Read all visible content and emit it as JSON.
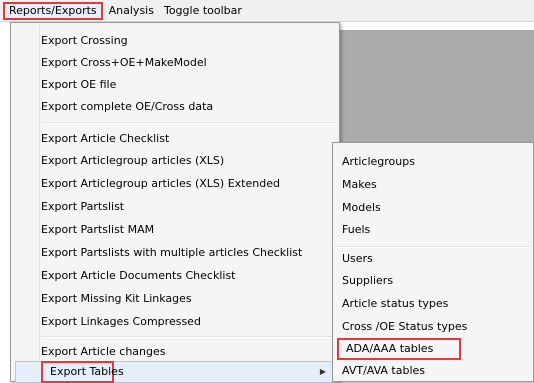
{
  "menubar": {
    "items": [
      {
        "label": "Reports/Exports"
      },
      {
        "label": "Analysis"
      },
      {
        "label": "Toggle toolbar"
      }
    ]
  },
  "main_menu": {
    "items": [
      "Export Crossing",
      "Export Cross+OE+MakeModel",
      "Export OE file",
      "Export complete OE/Cross data",
      "Export Article Checklist",
      "Export Articlegroup articles (XLS)",
      "Export Articlegroup articles (XLS) Extended",
      "Export Partslist",
      "Export Partslist MAM",
      "Export Partslists with multiple articles Checklist",
      "Export Article Documents Checklist",
      "Export Missing Kit Linkages",
      "Export Linkages Compressed",
      "Export Article changes",
      "Export Tables"
    ]
  },
  "sub_menu": {
    "items": [
      "Articlegroups",
      "Makes",
      "Models",
      "Fuels",
      "Users",
      "Suppliers",
      "Article status types",
      "Cross /OE Status types",
      "ADA/AAA tables",
      "AVT/AVA tables"
    ]
  },
  "colors": {
    "highlight_border": "#e03a3a",
    "menu_background": "#f5f5f5",
    "hover_background": "#e5eefb",
    "workspace_gray": "#ababab"
  }
}
